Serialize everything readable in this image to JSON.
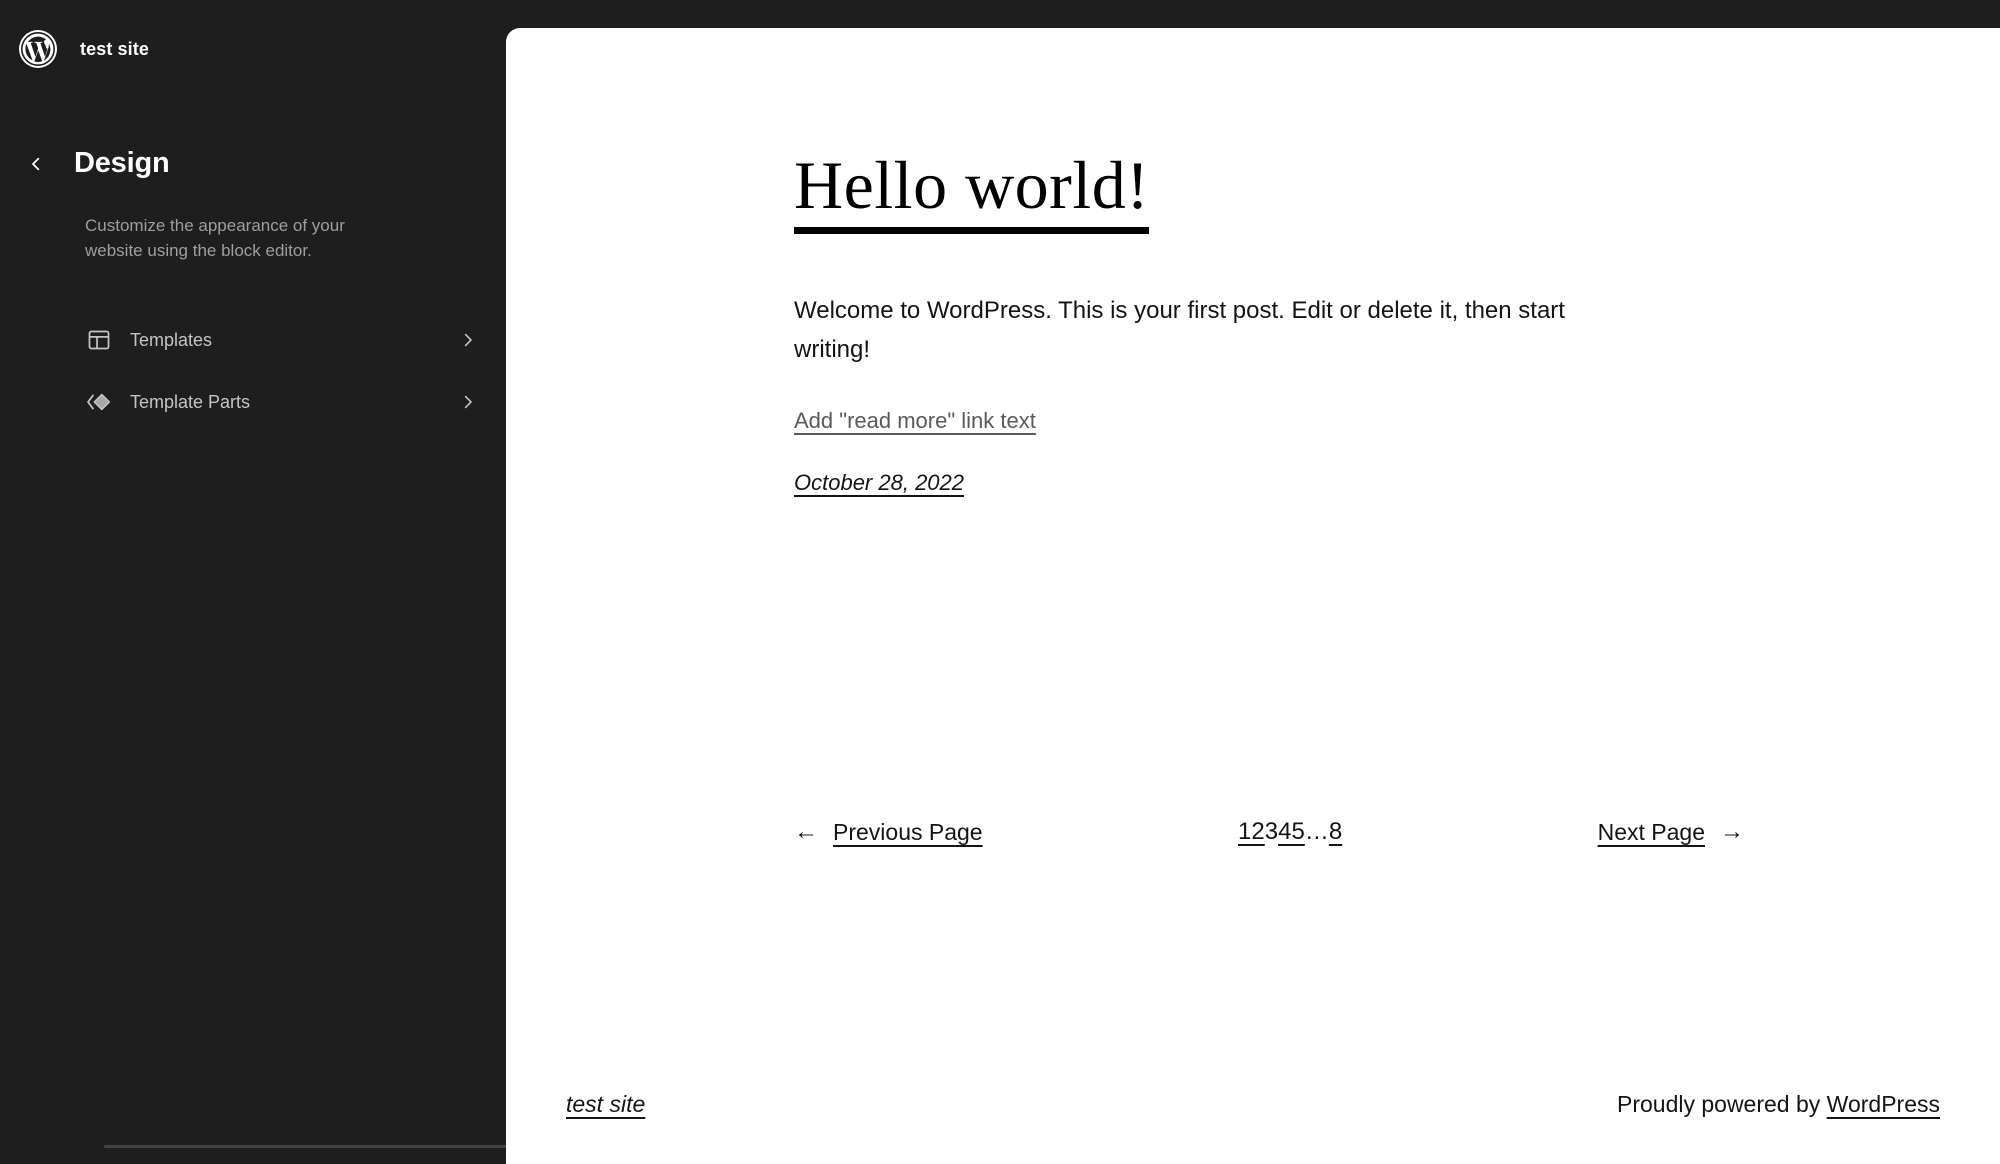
{
  "sidebar": {
    "site_title": "test site",
    "logo_icon": "wordpress-logo-icon",
    "back_icon": "chevron-left-icon",
    "panel_title": "Design",
    "panel_description": "Customize the appearance of your website using the block editor.",
    "nav_items": [
      {
        "label": "Templates",
        "icon": "layout-template-icon",
        "chevron": "chevron-right-icon"
      },
      {
        "label": "Template Parts",
        "icon": "template-parts-diamond-icon",
        "chevron": "chevron-right-icon"
      }
    ]
  },
  "canvas": {
    "post": {
      "title": "Hello world!",
      "excerpt": "Welcome to WordPress. This is your first post. Edit or delete it, then start writing!",
      "more_link": "Add \"read more\" link text",
      "date": "October 28, 2022"
    },
    "pagination": {
      "prev_arrow": "arrow-left-icon",
      "prev_label": "Previous Page",
      "next_label": "Next Page",
      "next_arrow": "arrow-right-icon",
      "numbers": [
        {
          "text": "1",
          "state": "link"
        },
        {
          "text": "2",
          "state": "link"
        },
        {
          "text": "3",
          "state": "current"
        },
        {
          "text": "4",
          "state": "link"
        },
        {
          "text": "5",
          "state": "link"
        },
        {
          "text": "…",
          "state": "dots"
        },
        {
          "text": "8",
          "state": "link"
        }
      ]
    },
    "footer": {
      "site_name": "test site",
      "credit_prefix": "Proudly powered by ",
      "credit_link": "WordPress"
    }
  },
  "colors": {
    "sidebar_bg": "#1e1e1e",
    "canvas_bg": "#ffffff",
    "sidebar_text": "#ffffff",
    "sidebar_muted": "#9e9e9e",
    "nav_label": "#c3c4c7",
    "content_text": "#141414",
    "muted_link": "#5a5a5a"
  }
}
